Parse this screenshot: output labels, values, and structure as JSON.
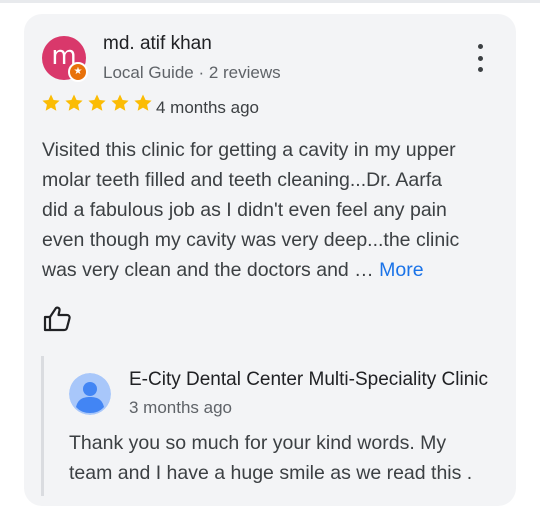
{
  "review": {
    "avatar_letter": "m",
    "avatar_color": "#d9386b",
    "badge_icon": "local-guide-star-icon",
    "reviewer_name": "md. atif khan",
    "reviewer_meta": "Local Guide · 2 reviews",
    "rating": 5,
    "star_color": "#fbbc04",
    "date": "4 months ago",
    "text_main": "Visited this clinic for getting a cavity in my upper\nmolar teeth filled and teeth cleaning...Dr. Aarfa\ndid a fabulous job as I didn't even feel any pain\neven though my cavity was very deep...the clinic\nwas very clean and the doctors and … ",
    "more_label": "More",
    "link_color": "#1a73e8",
    "like_icon": "thumbs-up-icon",
    "menu_icon": "more-vert-icon"
  },
  "reply": {
    "owner_avatar_icon": "default-profile-icon",
    "owner_name": "E-City Dental Center Multi-Speciality Clinic",
    "date": "3 months ago",
    "text": "Thank you so much for your kind words. My\nteam and I have a huge smile as we read this ."
  }
}
